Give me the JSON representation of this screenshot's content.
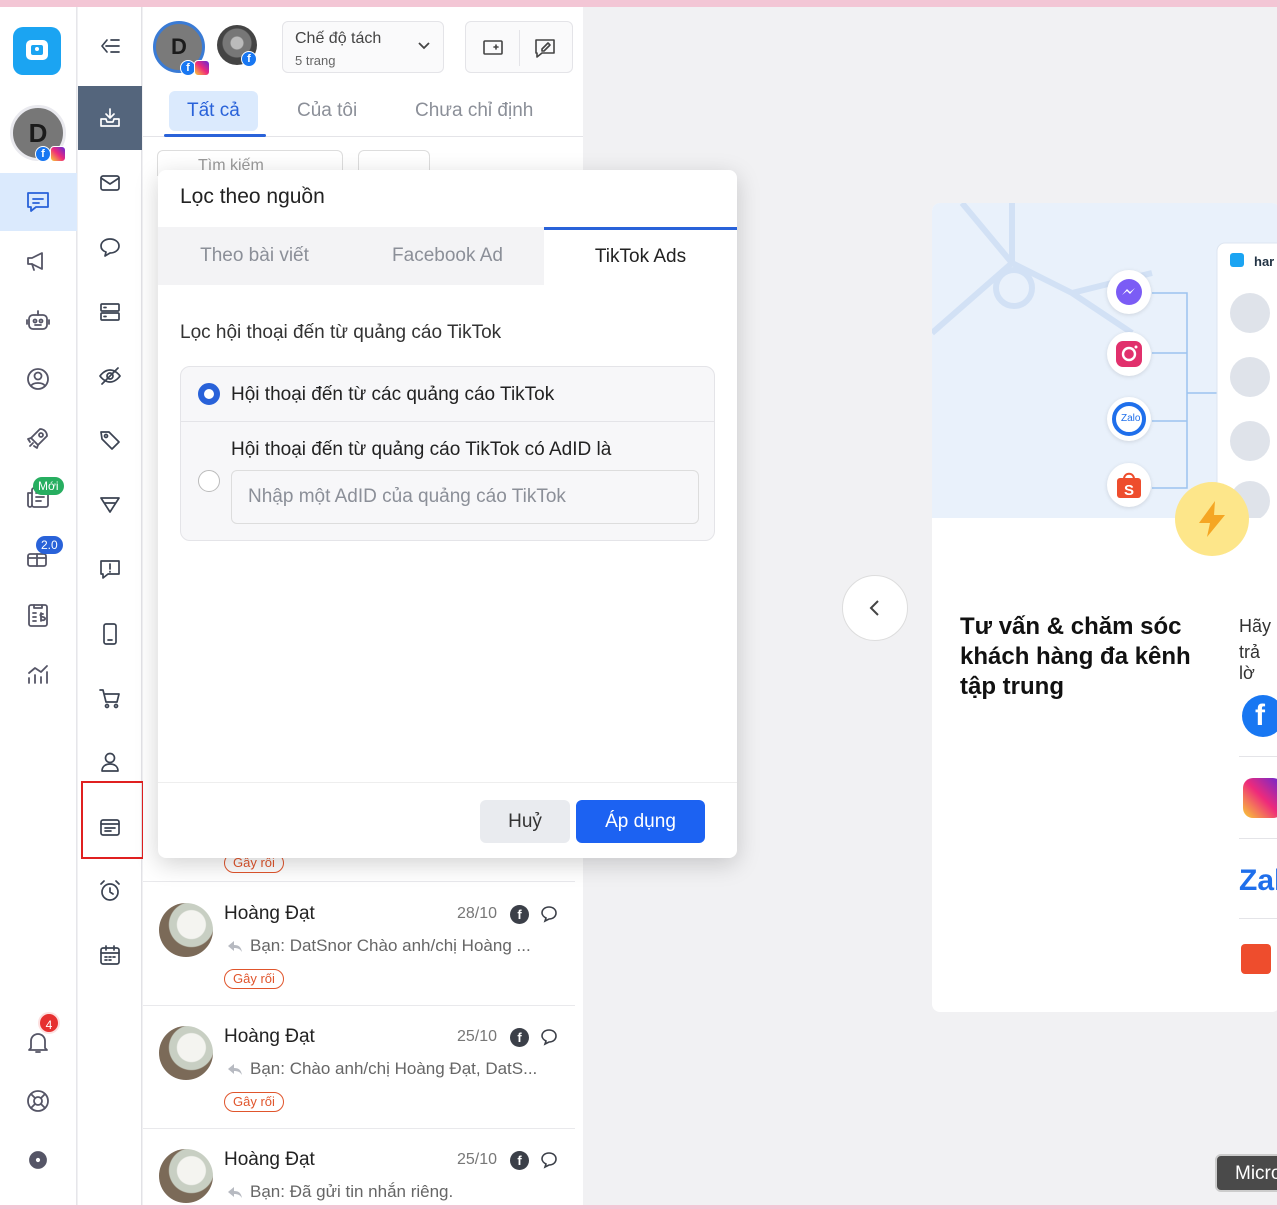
{
  "rail": {
    "avatar_letter": "D",
    "new_badge": "Mới",
    "version_badge": "2.0",
    "notification_count": "4"
  },
  "header": {
    "page_avatar_letter": "D",
    "mode_title": "Chế độ tách",
    "mode_subtitle": "5 trang"
  },
  "tabs": [
    {
      "label": "Tất cả"
    },
    {
      "label": "Của tôi"
    },
    {
      "label": "Chưa chỉ định"
    }
  ],
  "search": {
    "placeholder": "Tìm kiếm"
  },
  "conversations": [
    {
      "name": "",
      "date": "",
      "snippet": "",
      "tag": "Gây rối"
    },
    {
      "name": "Hoàng Đạt",
      "date": "28/10",
      "snippet": "Bạn: DatSnor Chào anh/chị Hoàng ...",
      "tag": "Gây rối"
    },
    {
      "name": "Hoàng Đạt",
      "date": "25/10",
      "snippet": "Bạn: Chào anh/chị Hoàng Đạt, DatS...",
      "tag": "Gây rối"
    },
    {
      "name": "Hoàng Đạt",
      "date": "25/10",
      "snippet": "Bạn: Đã gửi tin nhắn riêng.",
      "tag": ""
    }
  ],
  "modal": {
    "title": "Lọc theo nguồn",
    "tabs": [
      {
        "label": "Theo bài viết"
      },
      {
        "label": "Facebook Ad"
      },
      {
        "label": "TikTok Ads"
      }
    ],
    "section_title": "Lọc hội thoại đến từ quảng cáo TikTok",
    "option_all": "Hội thoại đến từ các quảng cáo TikTok",
    "option_adid": "Hội thoại đến từ quảng cáo TikTok có AdID là",
    "adid_placeholder": "Nhập một AdID của quảng cáo TikTok",
    "cancel_label": "Huỷ",
    "apply_label": "Áp dụng"
  },
  "promo": {
    "brand": "har",
    "title": "Tư vấn & chăm sóc khách hàng đa kênh tập trung",
    "side_text_1": "Hãy",
    "side_text_2": "trả lờ",
    "zalo_label": "Zal",
    "zalo_badge": "Zalo"
  },
  "micro_label": "Micro",
  "colors": {
    "accent": "#2962d9",
    "apply": "#1c62f2",
    "tag": "#e0552c",
    "frame": "#f3c6d5",
    "highlight": "#e02020"
  }
}
